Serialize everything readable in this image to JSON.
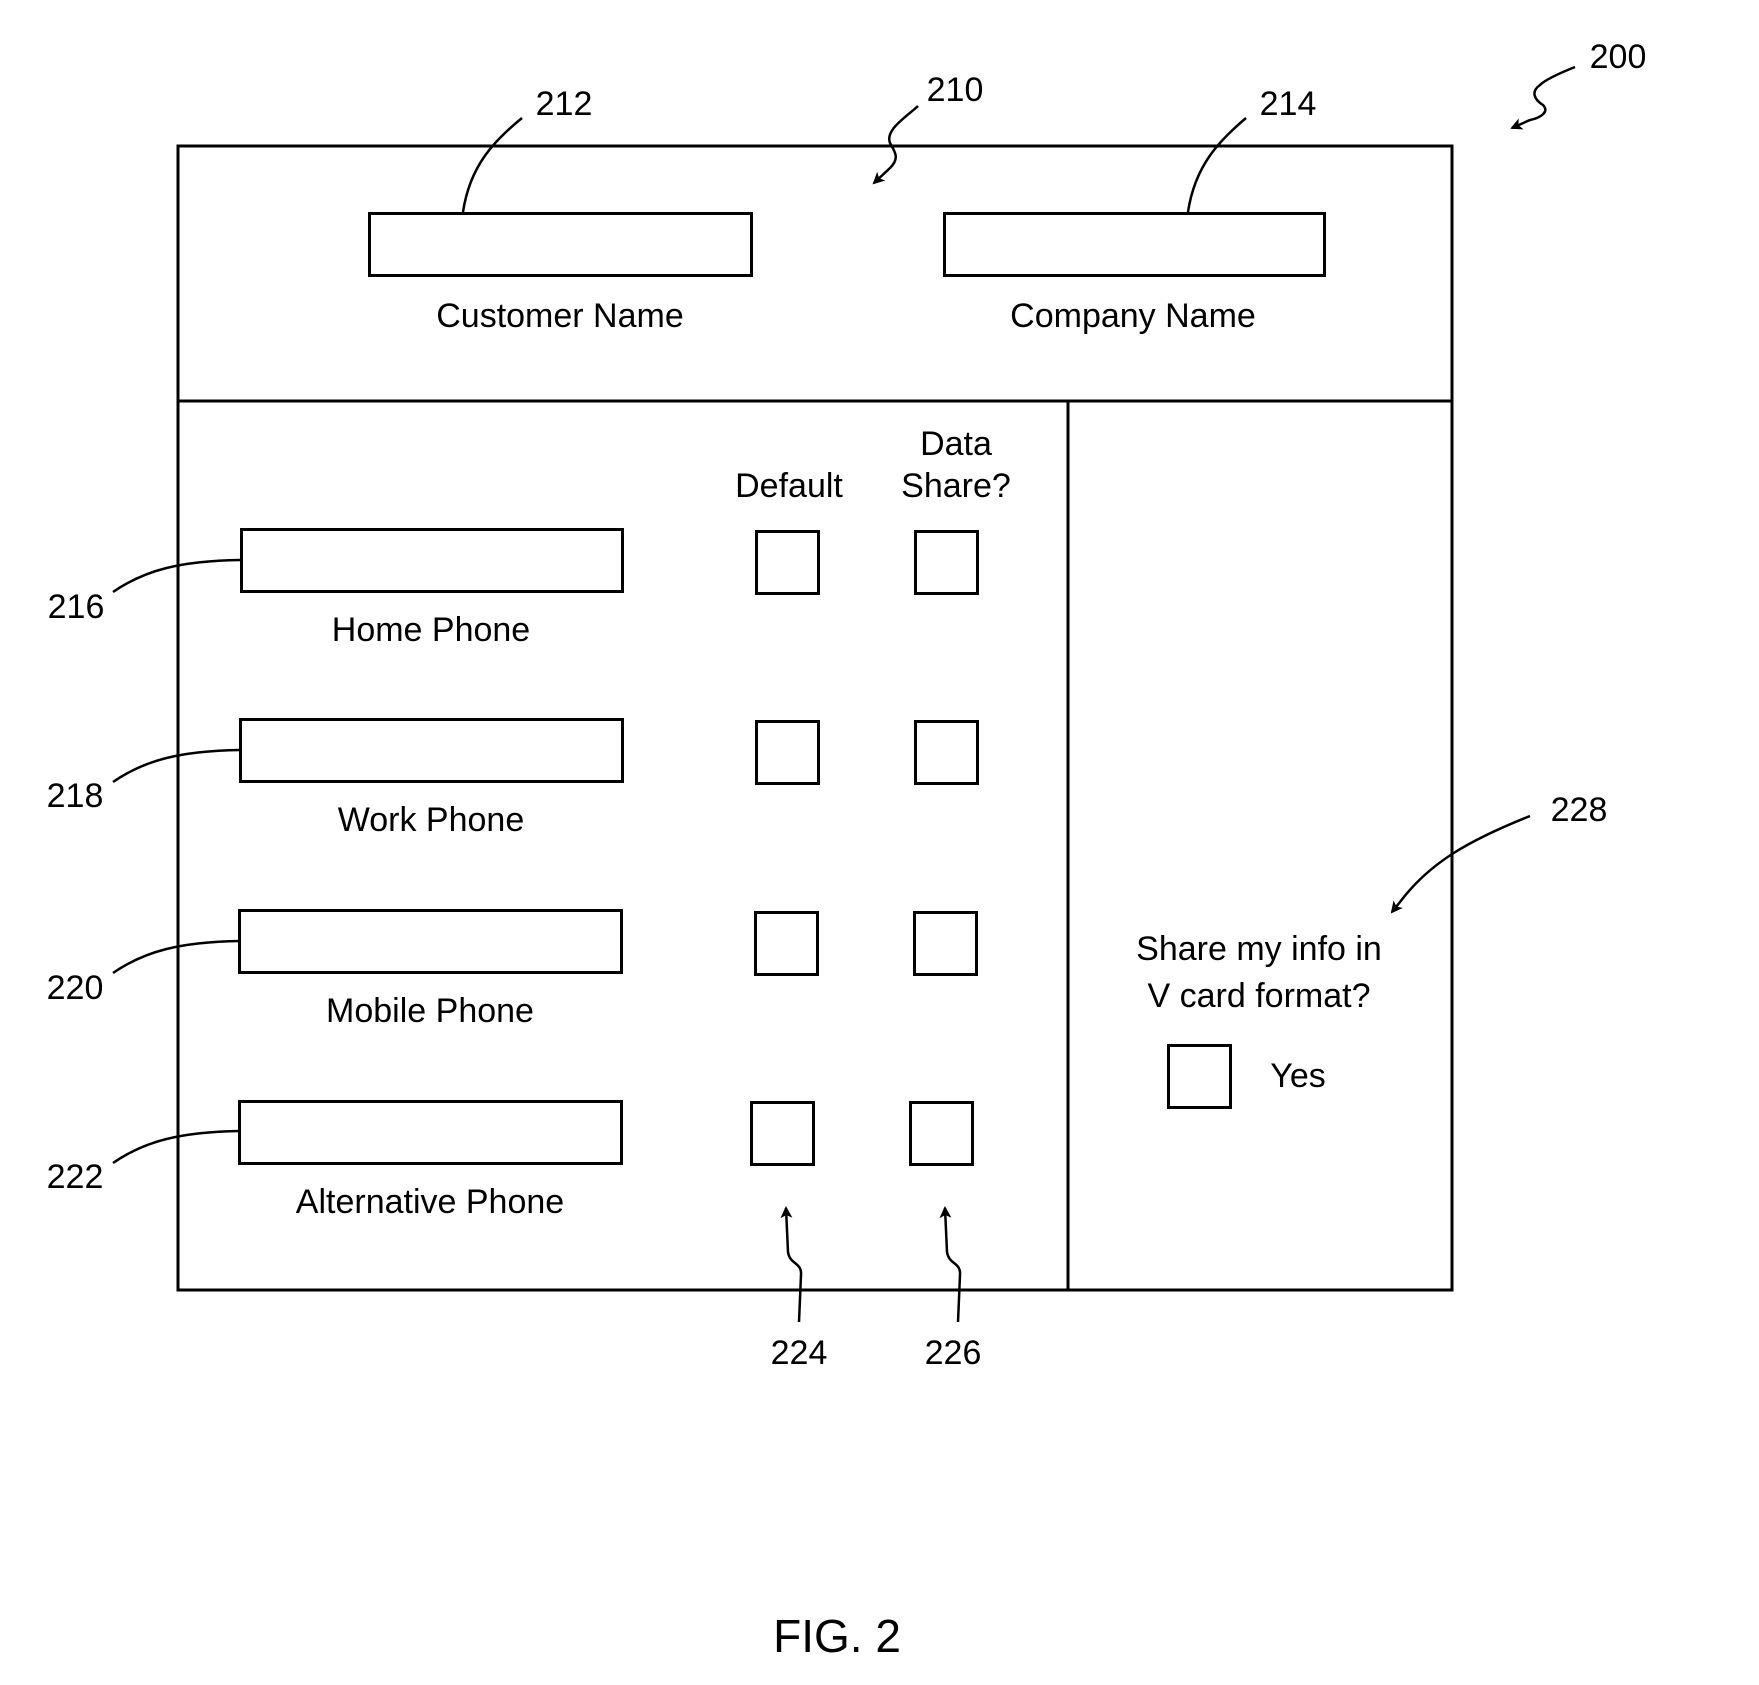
{
  "figure": {
    "caption": "FIG. 2",
    "ref_overall": "200",
    "ref_header_section": "210"
  },
  "header_section": {
    "customer_name": {
      "label": "Customer Name",
      "ref": "212",
      "value": ""
    },
    "company_name": {
      "label": "Company Name",
      "ref": "214",
      "value": ""
    }
  },
  "phone_section": {
    "column_headers": {
      "default": "Default",
      "data_share_line1": "Data",
      "data_share_line2": "Share?"
    },
    "rows": [
      {
        "label": "Home Phone",
        "ref": "216",
        "value": "",
        "default_checked": false,
        "data_share_checked": false
      },
      {
        "label": "Work Phone",
        "ref": "218",
        "value": "",
        "default_checked": false,
        "data_share_checked": false
      },
      {
        "label": "Mobile Phone",
        "ref": "220",
        "value": "",
        "default_checked": false,
        "data_share_checked": false
      },
      {
        "label": "Alternative Phone",
        "ref": "222",
        "value": "",
        "default_checked": false,
        "data_share_checked": false
      }
    ],
    "ref_default_column": "224",
    "ref_data_share_column": "226"
  },
  "vcard_section": {
    "ref": "228",
    "question_line1": "Share my info in",
    "question_line2": "V card format?",
    "option_label": "Yes",
    "checked": false
  }
}
